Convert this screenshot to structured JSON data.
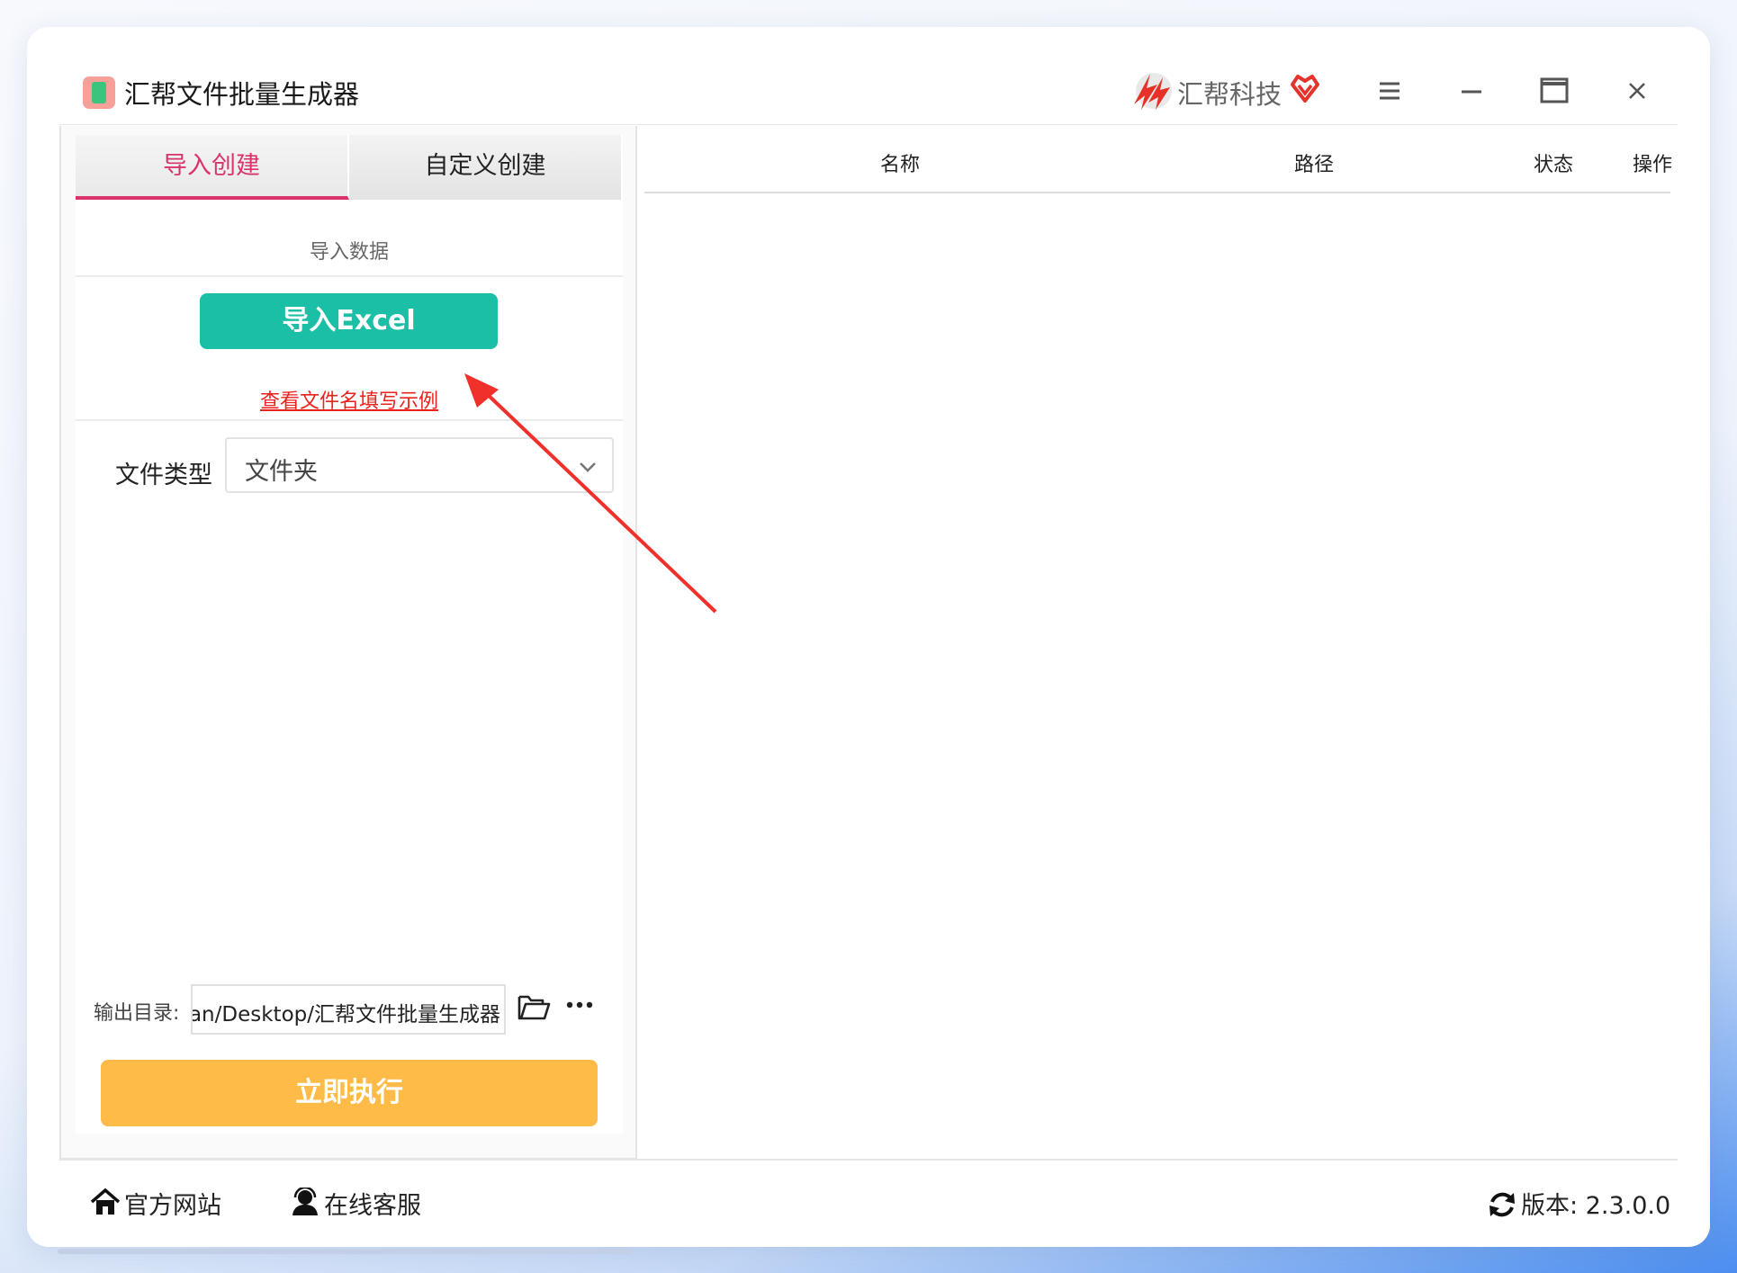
{
  "app": {
    "title": "汇帮文件批量生成器",
    "brand_name": "汇帮科技"
  },
  "tabs": [
    {
      "label": "导入创建",
      "active": true
    },
    {
      "label": "自定义创建",
      "active": false
    }
  ],
  "import": {
    "section_label": "导入数据",
    "button_label": "导入Excel",
    "example_link": "查看文件名填写示例"
  },
  "file_type": {
    "label": "文件类型",
    "selected": "文件夹"
  },
  "output": {
    "label": "输出目录:",
    "path": "uan/Desktop/汇帮文件批量生成器"
  },
  "run_button": "立即执行",
  "table": {
    "columns": [
      "名称",
      "路径",
      "状态",
      "操作"
    ],
    "rows": []
  },
  "footer": {
    "website": "官方网站",
    "support": "在线客服",
    "version": "版本:  2.3.0.0"
  },
  "colors": {
    "accent_tab": "#d9336a",
    "import_button": "#1bbfa6",
    "run_button": "#ffbb47",
    "link": "#e8231f",
    "annotation_arrow": "#f0302a"
  },
  "icons": [
    "app-icon",
    "brand-logo-icon",
    "heart-icon",
    "menu-icon",
    "minimize-icon",
    "maximize-icon",
    "close-icon",
    "chevron-down-icon",
    "folder-open-icon",
    "more-icon",
    "home-icon",
    "user-headset-icon",
    "refresh-icon"
  ]
}
